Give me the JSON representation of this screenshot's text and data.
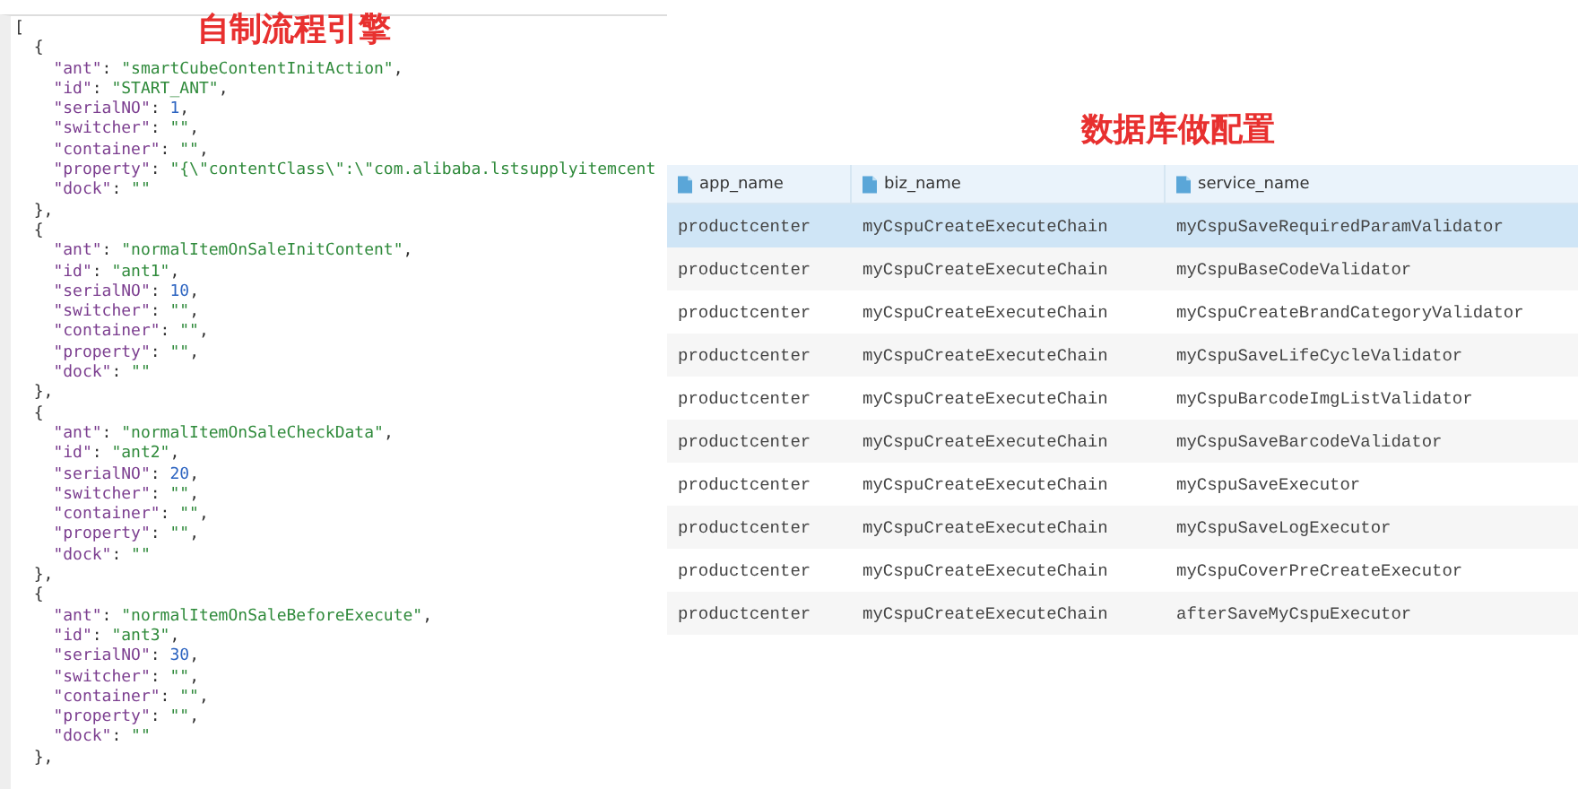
{
  "code_title": "自制流程引擎",
  "code_lines": [
    "[",
    "  {",
    "    \"ant\": \"smartCubeContentInitAction\",",
    "    \"id\": \"START_ANT\",",
    "    \"serialNO\": 1,",
    "    \"switcher\": \"\",",
    "    \"container\": \"\",",
    "    \"property\": \"{\\\"contentClass\\\":\\\"com.alibaba.lstsupplyitemcent",
    "    \"dock\": \"\"",
    "  },",
    "  {",
    "    \"ant\": \"normalItemOnSaleInitContent\",",
    "    \"id\": \"ant1\",",
    "    \"serialNO\": 10,",
    "    \"switcher\": \"\",",
    "    \"container\": \"\",",
    "    \"property\": \"\",",
    "    \"dock\": \"\"",
    "  },",
    "  {",
    "    \"ant\": \"normalItemOnSaleCheckData\",",
    "    \"id\": \"ant2\",",
    "    \"serialNO\": 20,",
    "    \"switcher\": \"\",",
    "    \"container\": \"\",",
    "    \"property\": \"\",",
    "    \"dock\": \"\"",
    "  },",
    "  {",
    "    \"ant\": \"normalItemOnSaleBeforeExecute\",",
    "    \"id\": \"ant3\",",
    "    \"serialNO\": 30,",
    "    \"switcher\": \"\",",
    "    \"container\": \"\",",
    "    \"property\": \"\",",
    "    \"dock\": \"\"",
    "  },"
  ],
  "table_title": "数据库做配置",
  "table": {
    "columns": [
      "app_name",
      "biz_name",
      "service_name"
    ],
    "rows": [
      {
        "selected": true,
        "cells": [
          "productcenter",
          "myCspuCreateExecuteChain",
          "myCspuSaveRequiredParamValidator"
        ]
      },
      {
        "selected": false,
        "cells": [
          "productcenter",
          "myCspuCreateExecuteChain",
          "myCspuBaseCodeValidator"
        ]
      },
      {
        "selected": false,
        "cells": [
          "productcenter",
          "myCspuCreateExecuteChain",
          "myCspuCreateBrandCategoryValidator"
        ]
      },
      {
        "selected": false,
        "cells": [
          "productcenter",
          "myCspuCreateExecuteChain",
          "myCspuSaveLifeCycleValidator"
        ]
      },
      {
        "selected": false,
        "cells": [
          "productcenter",
          "myCspuCreateExecuteChain",
          "myCspuBarcodeImgListValidator"
        ]
      },
      {
        "selected": false,
        "cells": [
          "productcenter",
          "myCspuCreateExecuteChain",
          "myCspuSaveBarcodeValidator"
        ]
      },
      {
        "selected": false,
        "cells": [
          "productcenter",
          "myCspuCreateExecuteChain",
          "myCspuSaveExecutor"
        ]
      },
      {
        "selected": false,
        "cells": [
          "productcenter",
          "myCspuCreateExecuteChain",
          "myCspuSaveLogExecutor"
        ]
      },
      {
        "selected": false,
        "cells": [
          "productcenter",
          "myCspuCreateExecuteChain",
          "myCspuCoverPreCreateExecutor"
        ]
      },
      {
        "selected": false,
        "cells": [
          "productcenter",
          "myCspuCreateExecuteChain",
          "afterSaveMyCspuExecutor"
        ]
      }
    ]
  }
}
